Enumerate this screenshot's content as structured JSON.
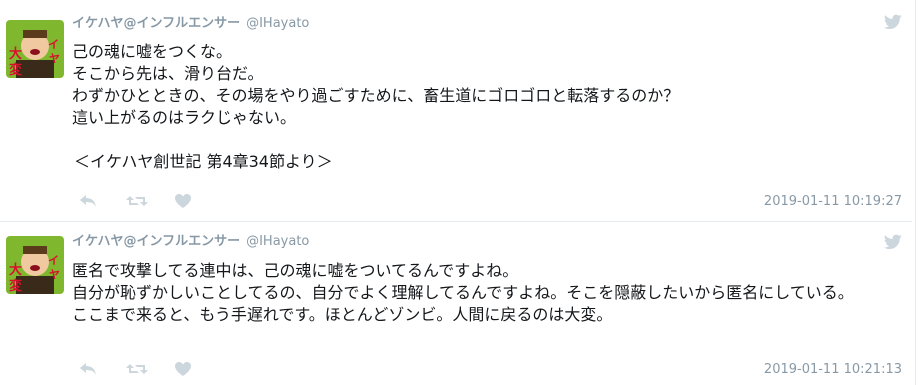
{
  "colors": {
    "muted": "#8899a6",
    "text": "#14171a",
    "divider": "#e6ecf0",
    "action_icon": "#ccd6dd",
    "avatar_bg": "#7fb82f"
  },
  "icons": {
    "reply": "reply-icon",
    "retweet": "retweet-icon",
    "like": "heart-icon",
    "service": "twitter-bird-icon"
  },
  "tweets": [
    {
      "display_name": "イケハヤ@インフルエンサー",
      "screen_name": "@IHayato",
      "lines": [
        "己の魂に嘘をつくな。",
        "そこから先は、滑り台だ。",
        "わずかひとときの、その場をやり過ごすために、畜生道にゴロゴロと転落するのか？",
        "這い上がるのはラクじゃない。",
        "",
        "＜イケハヤ創世記 第4章34節より＞"
      ],
      "timestamp": "2019-01-11 10:19:27"
    },
    {
      "display_name": "イケハヤ@インフルエンサー",
      "screen_name": "@IHayato",
      "lines": [
        "匿名で攻撃してる連中は、己の魂に嘘をついてるんですよね。",
        "自分が恥ずかしいことしてるの、自分でよく理解してるんですよね。そこを隠蔽したいから匿名にしている。",
        "ここまで来ると、もう手遅れです。ほとんどゾンビ。人間に戻るのは大変。"
      ],
      "timestamp": "2019-01-11 10:21:13"
    }
  ]
}
